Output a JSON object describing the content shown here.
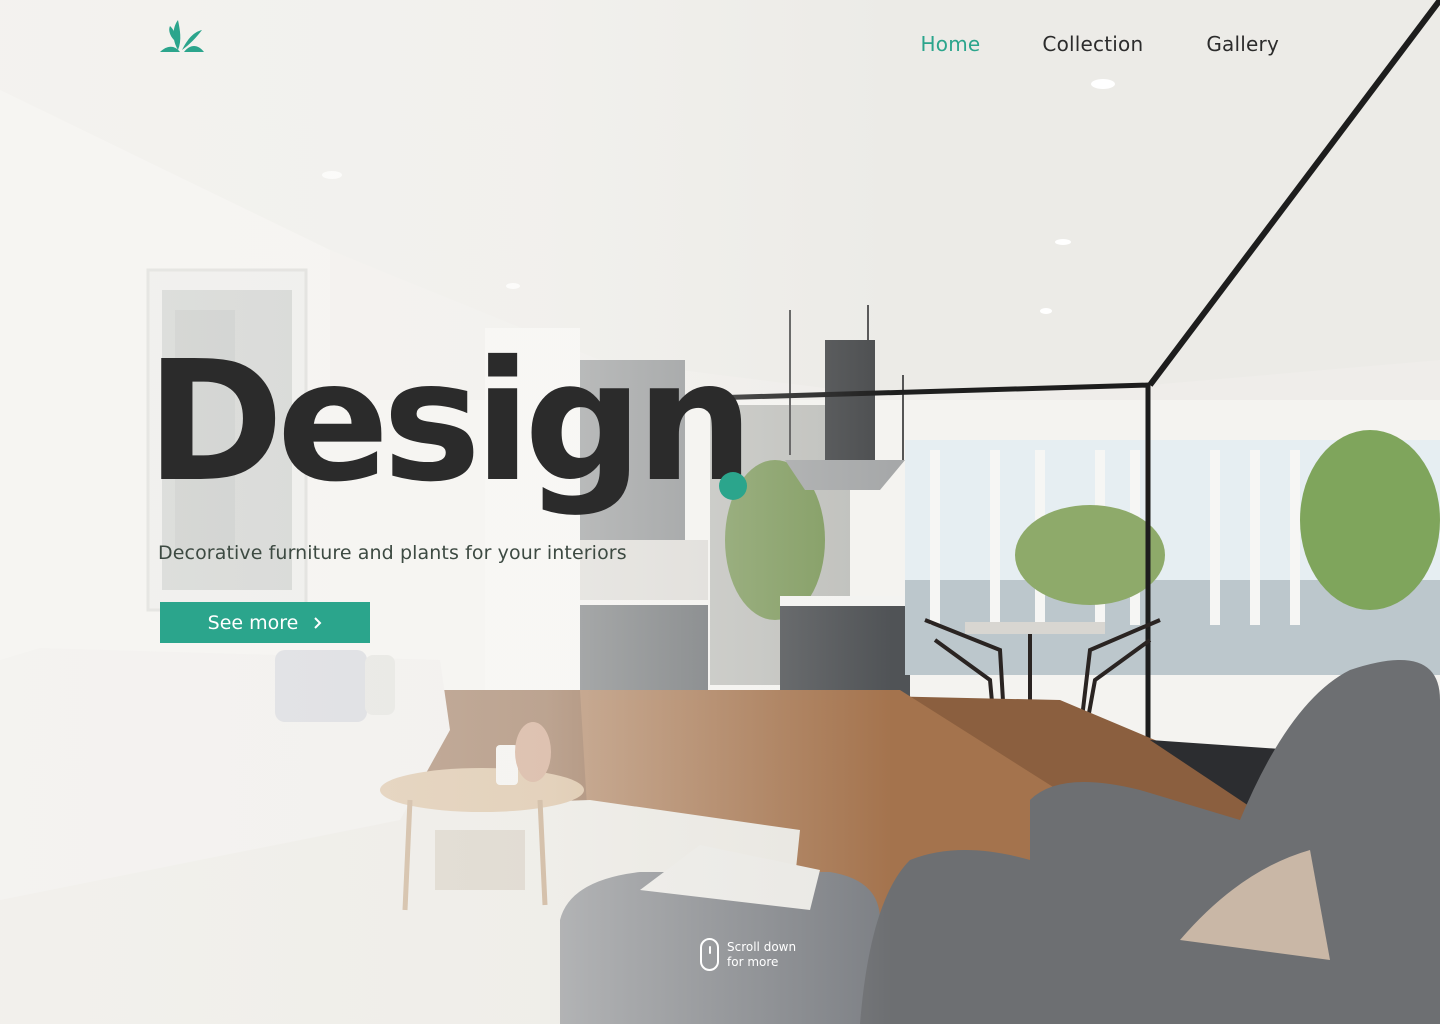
{
  "brand": {
    "logo_icon": "leaf-logo-icon",
    "accent": "#2ba58c"
  },
  "nav": {
    "items": [
      {
        "label": "Home",
        "active": true
      },
      {
        "label": "Collection",
        "active": false
      },
      {
        "label": "Gallery",
        "active": false
      }
    ]
  },
  "hero": {
    "title": "Design",
    "subtitle": "Decorative furniture and plants for your interiors",
    "cta_label": "See more",
    "cta_icon": "chevron-right-icon"
  },
  "scroll_hint": {
    "line1": "Scroll down",
    "line2": "for more",
    "icon": "mouse-icon"
  },
  "colors": {
    "text_dark": "#2b2b2b",
    "accent": "#2ba58c",
    "subtitle": "#3d4a42"
  }
}
